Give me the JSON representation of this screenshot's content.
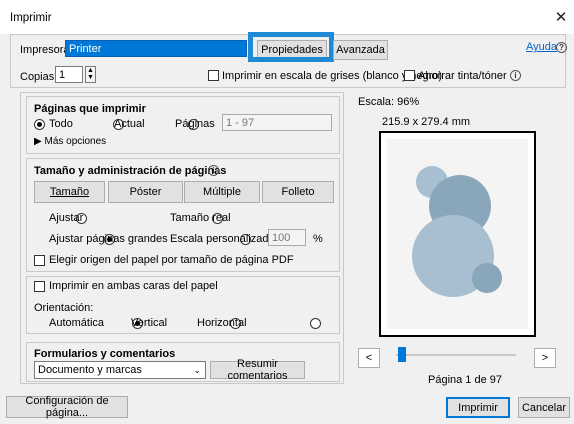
{
  "window": {
    "title": "Imprimir",
    "close_glyph": "✕"
  },
  "printer": {
    "label": "Impresora:",
    "value": "Printer",
    "properties_button": "Propiedades",
    "advanced_button": "Avanzada",
    "help_link": "Ayuda",
    "copies_label": "Copias:",
    "copies_value": "1",
    "grayscale_label": "Imprimir en escala de grises (blanco y negro)",
    "save_ink_label": "Ahorrar tinta/tóner"
  },
  "pages": {
    "heading": "Páginas que imprimir",
    "all": "Todo",
    "current": "Actual",
    "pages_option": "Páginas",
    "range_value": "1 - 97",
    "more_options": "Más opciones"
  },
  "sizing": {
    "heading": "Tamaño y administración de páginas",
    "tabs": [
      "Tamaño",
      "Póster",
      "Múltiple",
      "Folleto"
    ],
    "fit": "Ajustar",
    "actual_size": "Tamaño real",
    "shrink_large": "Ajustar páginas grandes",
    "custom_scale": "Escala personalizada:",
    "scale_value": "100",
    "percent": "%",
    "paper_source": "Elegir origen del papel por tamaño de página PDF"
  },
  "duplex": {
    "both_sides": "Imprimir en ambas caras del papel",
    "orientation_label": "Orientación:",
    "auto": "Automática",
    "vertical": "Vertical",
    "horizontal": "Horizontal"
  },
  "forms": {
    "heading": "Formularios y comentarios",
    "selected": "Documento y marcas",
    "summarize_button": "Resumir comentarios"
  },
  "preview": {
    "scale_label": "Escala: 96%",
    "dimensions": "215.9 x 279.4 mm",
    "page_status": "Página 1 de 97",
    "prev_glyph": "<",
    "next_glyph": ">",
    "slider_fraction": 0.0
  },
  "footer": {
    "page_setup": "Configuración de página...",
    "print": "Imprimir",
    "cancel": "Cancelar"
  },
  "colors": {
    "accent": "#0078d7",
    "highlight_box": "#1e8ad6",
    "circle": "#a7bfd0",
    "circle_dark": "#8aa6ba",
    "selection": "#0078d7"
  }
}
